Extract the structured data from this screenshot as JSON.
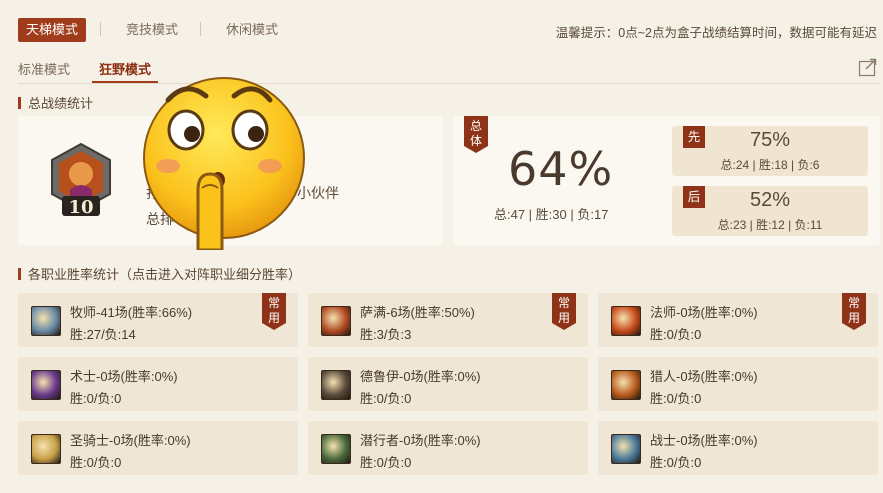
{
  "top_tabs": [
    {
      "label": "天梯模式",
      "active": true
    },
    {
      "label": "竞技模式",
      "active": false
    },
    {
      "label": "休闲模式",
      "active": false
    }
  ],
  "tip": "温馨提示：0点~2点为盒子战绩结算时间，数据可能有延迟",
  "sub_tabs": [
    {
      "label": "标准模式",
      "active": false
    },
    {
      "label": "狂野模式",
      "active": true
    }
  ],
  "overall": {
    "section_title": "总战绩统计",
    "badge_rank": "10",
    "player_line1": "打",
    "player_line1_suffix": "小伙伴",
    "player_line2": "总排",
    "total_tag": "总\n体",
    "win_rate": "64%",
    "summary": "总:47 | 胜:30 | 负:17",
    "first": {
      "tag": "先",
      "rate": "75%",
      "summary": "总:24 | 胜:18 | 负:6"
    },
    "second": {
      "tag": "后",
      "rate": "52%",
      "summary": "总:23 | 胜:12 | 负:11"
    }
  },
  "classes_section_title": "各职业胜率统计（点击进入对阵职业细分胜率）",
  "common_tag": "常\n用",
  "classes": [
    {
      "title": "牧师-41场(胜率:66%)",
      "record": "胜:27/负:14",
      "common": true,
      "icon": "priest-icon",
      "color": "#6a8aa6"
    },
    {
      "title": "萨满-6场(胜率:50%)",
      "record": "胜:3/负:3",
      "common": true,
      "icon": "shaman-icon",
      "color": "#b24a22"
    },
    {
      "title": "法师-0场(胜率:0%)",
      "record": "胜:0/负:0",
      "common": true,
      "icon": "mage-icon",
      "color": "#c84a1c"
    },
    {
      "title": "术士-0场(胜率:0%)",
      "record": "胜:0/负:0",
      "common": false,
      "icon": "warlock-icon",
      "color": "#6a3a8a"
    },
    {
      "title": "德鲁伊-0场(胜率:0%)",
      "record": "胜:0/负:0",
      "common": false,
      "icon": "druid-icon",
      "color": "#5a4a3a"
    },
    {
      "title": "猎人-0场(胜率:0%)",
      "record": "胜:0/负:0",
      "common": false,
      "icon": "hunter-icon",
      "color": "#b85a1c"
    },
    {
      "title": "圣骑士-0场(胜率:0%)",
      "record": "胜:0/负:0",
      "common": false,
      "icon": "paladin-icon",
      "color": "#c8a048"
    },
    {
      "title": "潜行者-0场(胜率:0%)",
      "record": "胜:0/负:0",
      "common": false,
      "icon": "rogue-icon",
      "color": "#4a6a3a"
    },
    {
      "title": "战士-0场(胜率:0%)",
      "record": "胜:0/负:0",
      "common": false,
      "icon": "warrior-icon",
      "color": "#4a7a9a"
    }
  ],
  "colors": {
    "accent": "#a03c1c",
    "ribbon": "#8e3317",
    "page_bg": "#f6f1e7"
  }
}
